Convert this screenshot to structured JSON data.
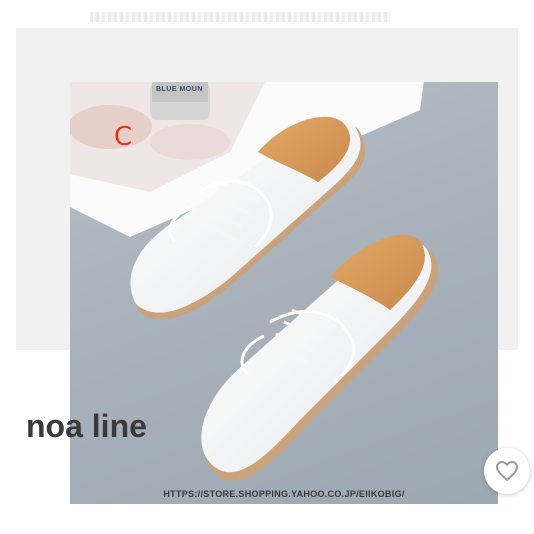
{
  "product": {
    "variant_label": "C",
    "magazine_text": "BLUE MOUN",
    "url_caption": "HTTPS://STORE.SHOPPING.YAHOO.CO.JP/EIIKOBIG/"
  },
  "brand": {
    "name": "noa line"
  },
  "actions": {
    "favorite_icon": "heart-outline-icon"
  },
  "colors": {
    "variant_letter": "#e0341e",
    "brand_text": "#3a3a3a",
    "photo_background": "#a9b2bb"
  }
}
